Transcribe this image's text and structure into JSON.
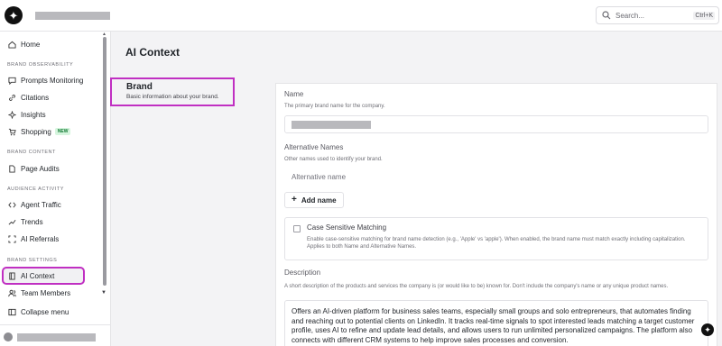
{
  "header": {
    "logo_icon": "asterisk-logo-icon",
    "search": {
      "placeholder": "Search...",
      "shortcut": "Ctrl+K"
    }
  },
  "sidebar": {
    "home": "Home",
    "brand_observability": {
      "label": "BRAND OBSERVABILITY",
      "items": [
        "Prompts Monitoring",
        "Citations",
        "Insights",
        "Shopping"
      ],
      "shopping_badge": "NEW"
    },
    "brand_content": {
      "label": "BRAND CONTENT",
      "items": [
        "Page Audits"
      ]
    },
    "audience_activity": {
      "label": "AUDIENCE ACTIVITY",
      "items": [
        "Agent Traffic",
        "Trends",
        "AI Referrals"
      ]
    },
    "brand_settings": {
      "label": "BRAND SETTINGS",
      "items": [
        "AI Context",
        "Team Members"
      ]
    },
    "active_item": "AI Context",
    "collapse": "Collapse menu"
  },
  "main": {
    "title": "AI Context",
    "section": {
      "title": "Brand",
      "subtitle": "Basic information about your brand."
    },
    "fields": {
      "name": {
        "label": "Name",
        "help": "The primary brand name for the company."
      },
      "alt_names": {
        "label": "Alternative Names",
        "help": "Other names used to identify your brand.",
        "placeholder": "Alternative name",
        "add_label": "Add name"
      },
      "case_sensitive": {
        "label": "Case Sensitive Matching",
        "checked": false,
        "desc": "Enable case-sensitive matching for brand name detection (e.g., 'Apple' vs 'apple'). When enabled, the brand name must match exactly including capitalization. Applies to both Name and Alternative Names."
      },
      "description": {
        "label": "Description",
        "help": "A short description of the products and services the company is (or would like to be) known for. Don't include the company's name or any unique product names.",
        "value": "Offers an AI-driven platform for business sales teams, especially small groups and solo entrepreneurs, that automates finding and reaching out to potential clients on LinkedIn. It tracks real-time signals to spot interested leads matching a target customer profile, uses AI to refine and update lead details, and allows users to run unlimited personalized campaigns. The platform also connects with different CRM systems to help improve sales processes and conversion."
      }
    }
  },
  "colors": {
    "highlight": "#c02fc2",
    "badge_green": "#137a35"
  }
}
